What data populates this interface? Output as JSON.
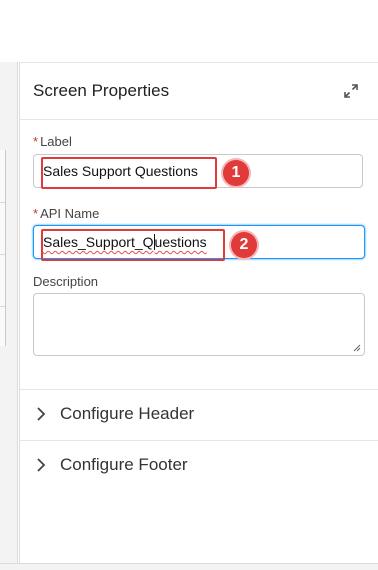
{
  "panel": {
    "title": "Screen Properties",
    "expand_icon": "expand-icon"
  },
  "fields": {
    "label": {
      "required_marker": "*",
      "label": "Label",
      "value": "Sales Support Questions"
    },
    "api_name": {
      "required_marker": "*",
      "label": "API Name",
      "value_before_caret": "Sales_Support_Q",
      "value_after_caret": "uestions"
    },
    "description": {
      "label": "Description",
      "value": ""
    }
  },
  "annotations": {
    "badge_1": "1",
    "badge_2": "2",
    "color": "#e03a3a"
  },
  "sections": [
    {
      "label": "Configure Header",
      "icon": "chevron-right-icon"
    },
    {
      "label": "Configure Footer",
      "icon": "chevron-right-icon"
    }
  ],
  "colors": {
    "focus": "#1b96ff",
    "required": "#c23934"
  }
}
